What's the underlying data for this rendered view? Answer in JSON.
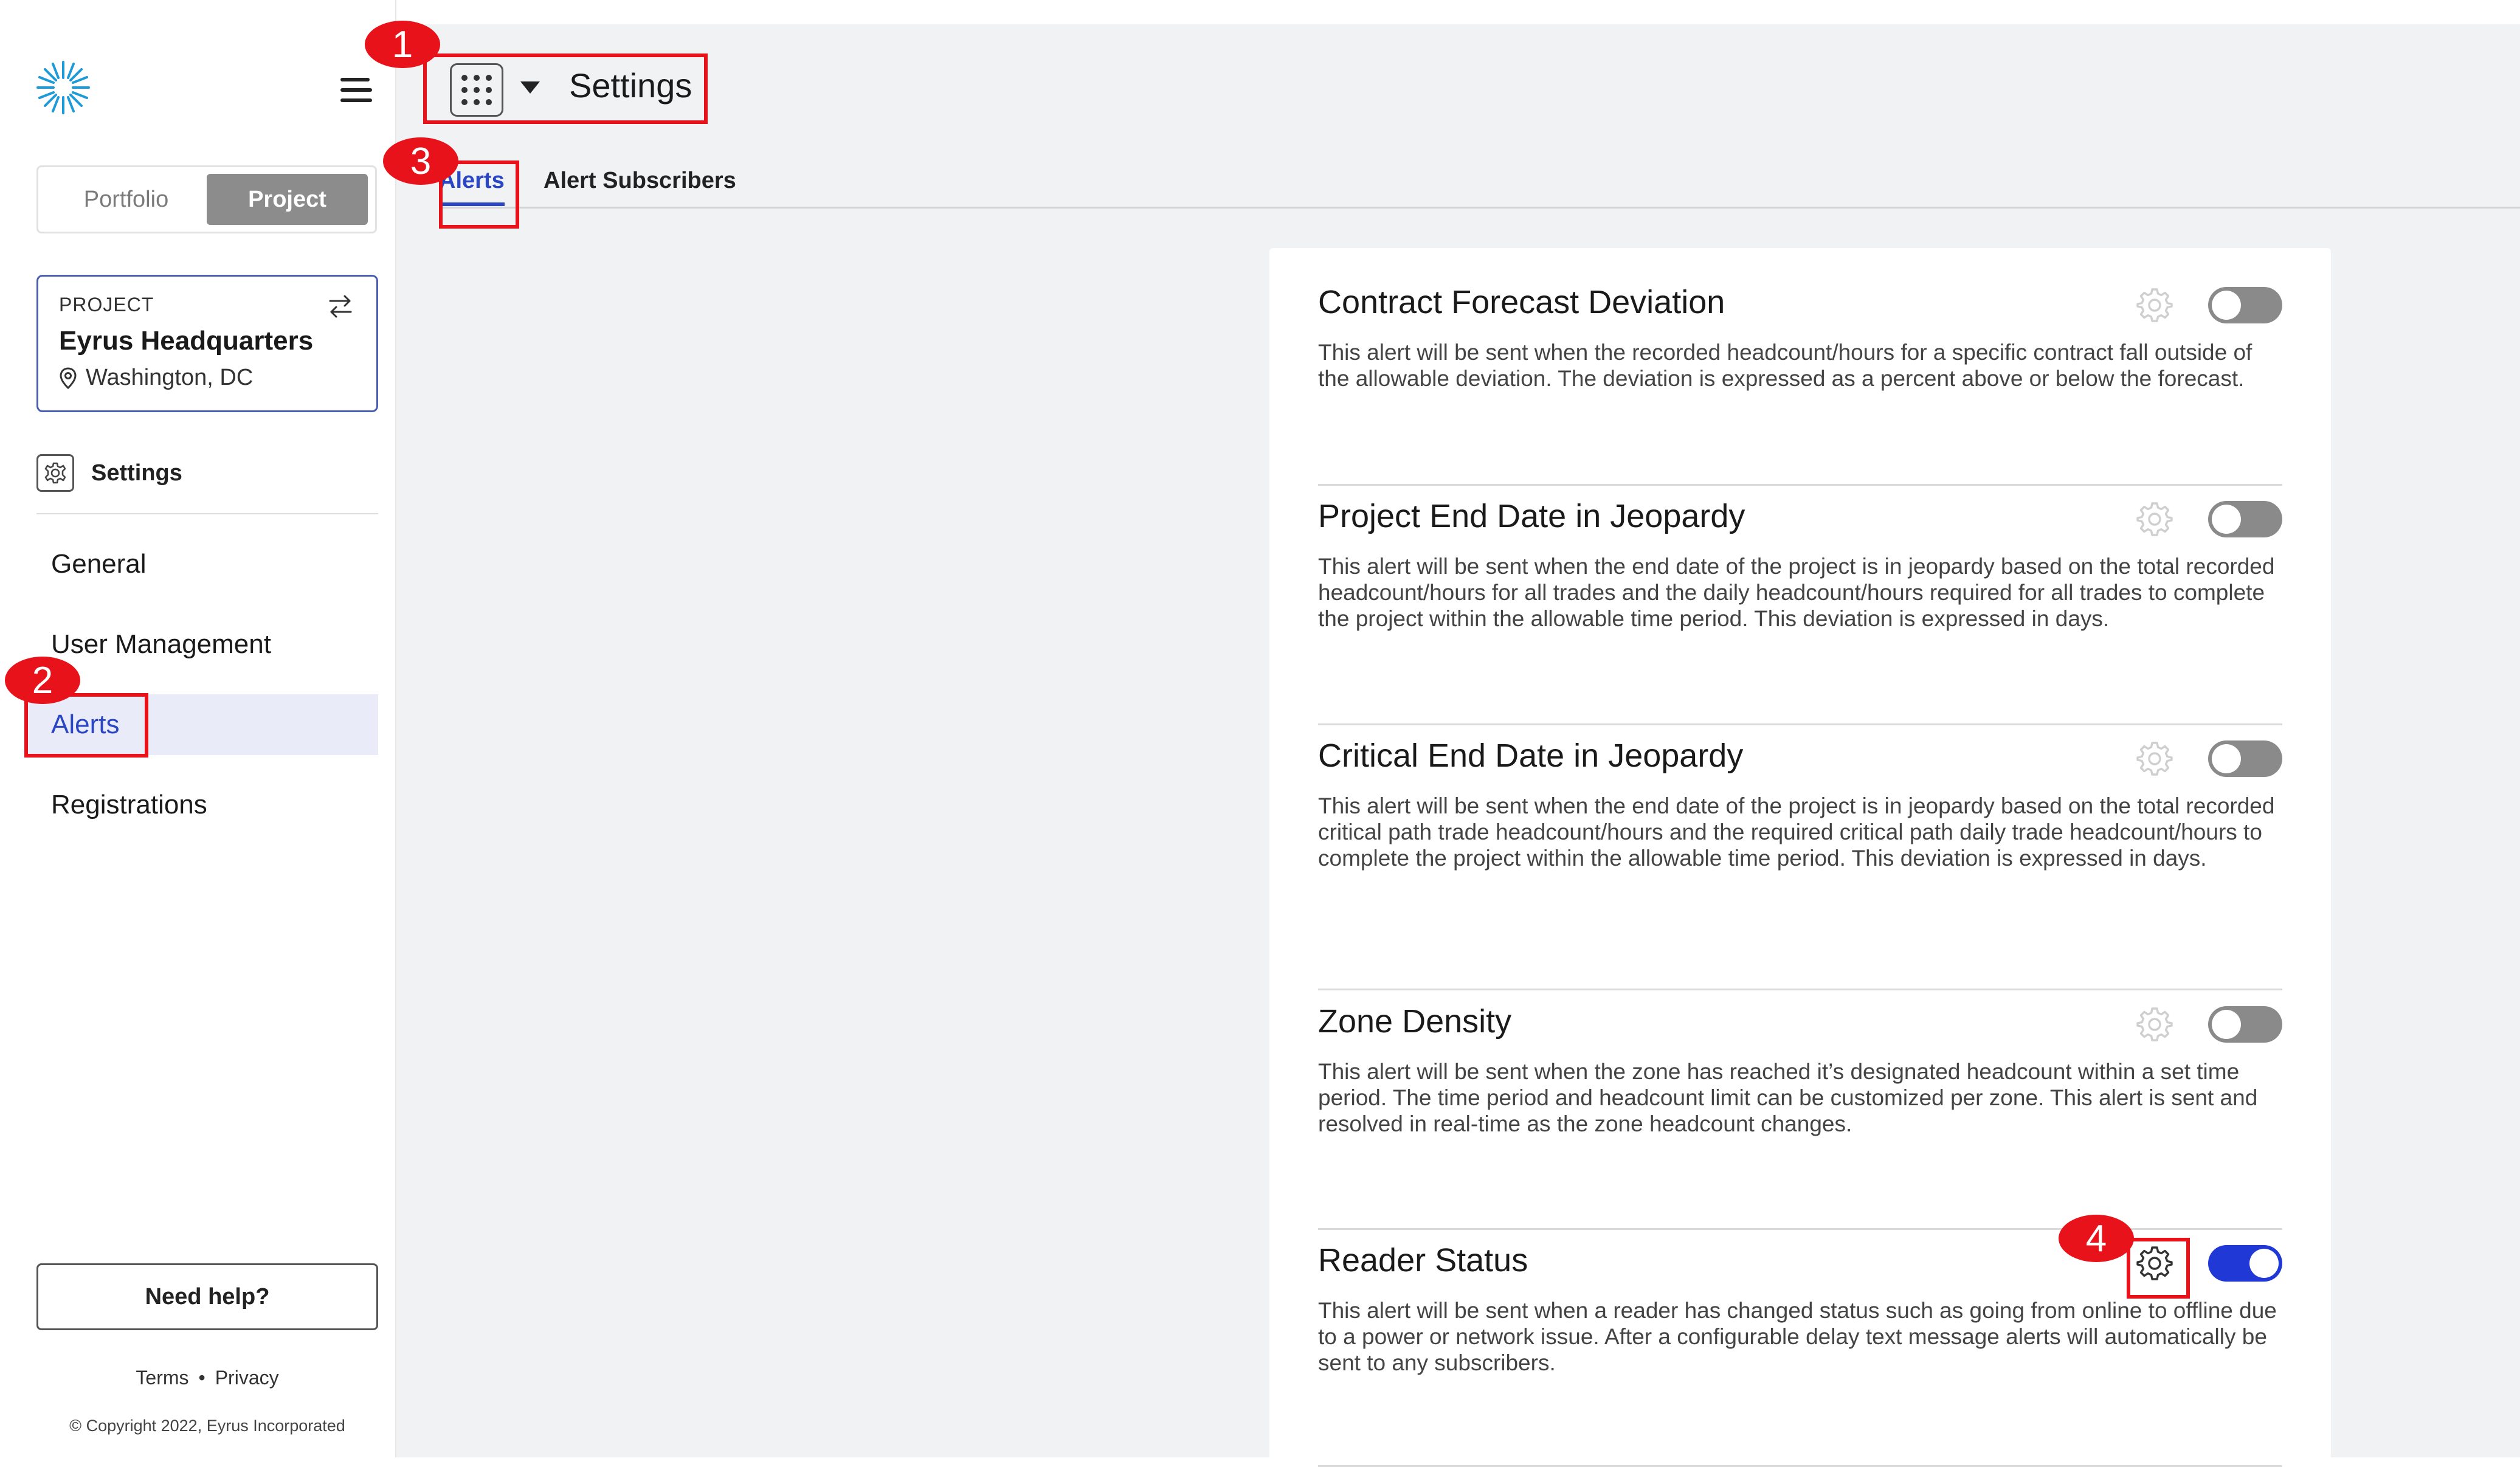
{
  "sidebar": {
    "scope_toggle": [
      "Portfolio",
      "Project"
    ],
    "active_scope": "Project",
    "project": {
      "label": "PROJECT",
      "name": "Eyrus Headquarters",
      "location": "Washington, DC"
    },
    "settings_label": "Settings",
    "nav": [
      "General",
      "User Management",
      "Alerts",
      "Registrations"
    ],
    "active_nav": "Alerts",
    "need_help": "Need help?",
    "links": [
      "Terms",
      "Privacy"
    ],
    "copyright": "© Copyright 2022, Eyrus Incorporated"
  },
  "header": {
    "title": "Settings"
  },
  "tabs": [
    "Alerts",
    "Alert Subscribers"
  ],
  "active_tab": "Alerts",
  "alerts": [
    {
      "title": "Contract Forecast Deviation",
      "description": "This alert will be sent when the recorded headcount/hours for a specific contract fall outside of the allowable deviation. The deviation is expressed as a percent above or below the forecast.",
      "enabled": false
    },
    {
      "title": "Project End Date in Jeopardy",
      "description": "This alert will be sent when the end date of the project is in jeopardy based on the total recorded headcount/hours for all trades and the daily headcount/hours required for all trades to complete the project within the allowable time period. This deviation is expressed in days.",
      "enabled": false
    },
    {
      "title": "Critical End Date in Jeopardy",
      "description": "This alert will be sent when the end date of the project is in jeopardy based on the total recorded critical path trade headcount/hours and the required critical path daily trade headcount/hours to complete the project within the allowable time period. This deviation is expressed in days.",
      "enabled": false
    },
    {
      "title": "Zone Density",
      "description": "This alert will be sent when the zone has reached it’s designated headcount within a set time period. The time period and headcount limit can be customized per zone. This alert is sent and resolved in real-time as the zone headcount changes.",
      "enabled": false
    },
    {
      "title": "Reader Status",
      "description": "This alert will be sent when a reader has changed status such as going from online to offline due to a power or network issue. After a configurable delay text message alerts will automatically be sent to any subscribers.",
      "enabled": true
    }
  ],
  "annotations": [
    "1",
    "2",
    "3",
    "4"
  ],
  "colors": {
    "accent": "#2b46c2",
    "toggle_on": "#1f38d6",
    "toggle_off": "#8a8a8a",
    "annotation": "#e8121a"
  }
}
